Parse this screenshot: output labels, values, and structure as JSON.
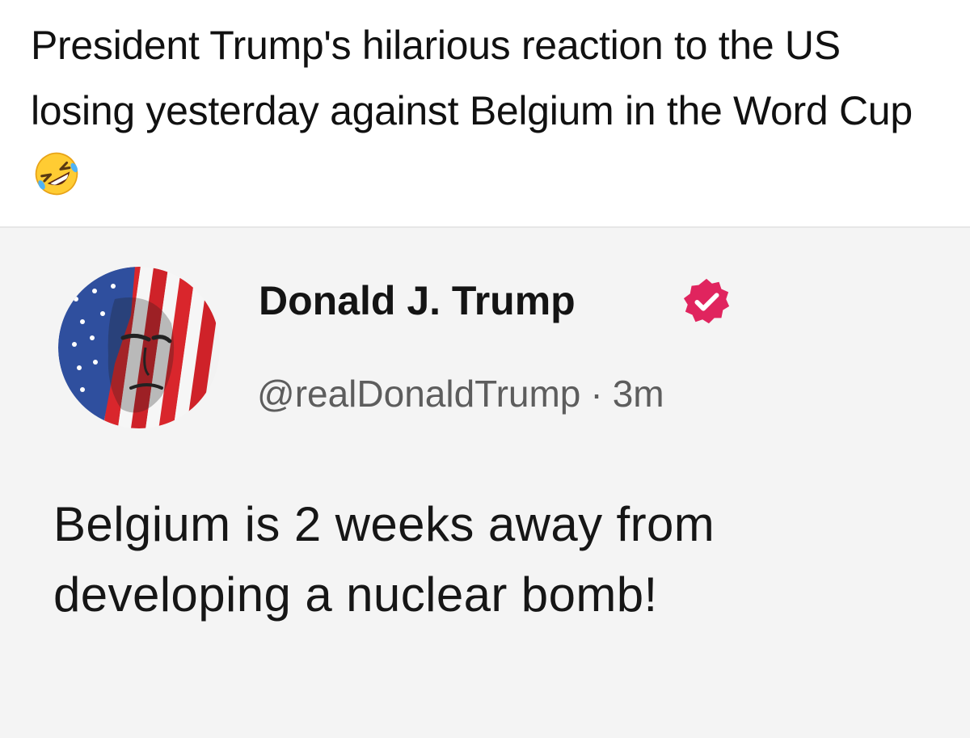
{
  "caption": {
    "text": "President Trump's hilarious reaction to the US losing yesterday against Belgium in the Word Cup",
    "emoji": "rolling-on-floor-laughing-emoji"
  },
  "tweet": {
    "author": {
      "display_name": "Donald J. Trump",
      "handle": "@realDonaldTrump",
      "separator": "·",
      "time": "3m",
      "verified": true,
      "avatar": "avatar"
    },
    "body": "Belgium is 2 weeks away from developing a nuclear bomb!"
  },
  "colors": {
    "background": "#ffffff",
    "card_background": "#f4f4f4",
    "verified_badge": "#e0245e",
    "handle_text": "#5d5d5d"
  }
}
